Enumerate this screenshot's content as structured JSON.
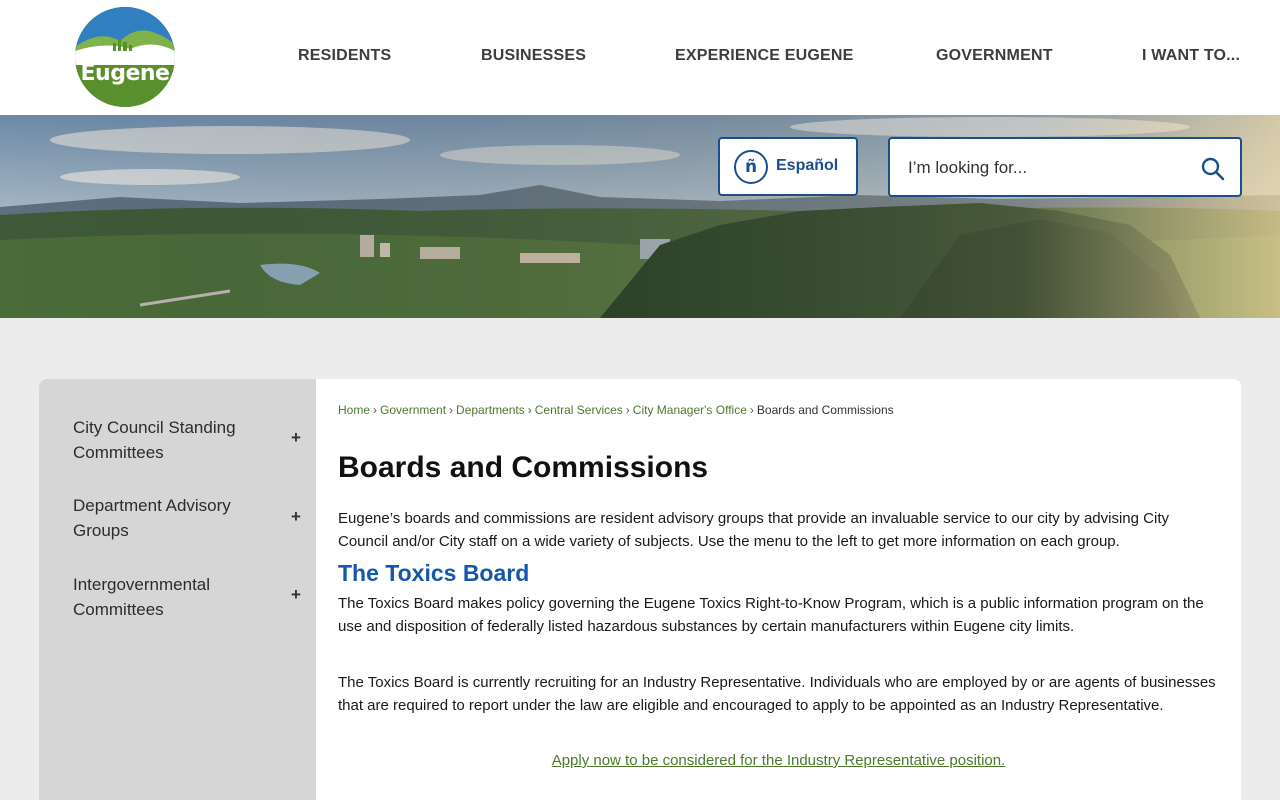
{
  "header": {
    "logo_text": "Eugene",
    "nav": [
      "RESIDENTS",
      "BUSINESSES",
      "EXPERIENCE EUGENE",
      "GOVERNMENT",
      "I WANT TO..."
    ]
  },
  "hero": {
    "language_button": "Español",
    "language_icon": "ñ",
    "search": {
      "placeholder": "I’m looking for..."
    }
  },
  "sidebar": {
    "items": [
      {
        "label": "City Council Standing Committees",
        "expand": "+"
      },
      {
        "label": "Department Advisory Groups",
        "expand": "+"
      },
      {
        "label": "Intergovernmental Committees",
        "expand": "+"
      }
    ]
  },
  "breadcrumb": {
    "links": [
      "Home",
      "Government",
      "Departments",
      "Central Services",
      "City Manager's Office"
    ],
    "separator": "›",
    "current": "Boards and Commissions"
  },
  "main": {
    "title": "Boards and Commissions",
    "intro": "Eugene’s boards and commissions are resident advisory groups that provide an invaluable service to our city by advising City Council and/or City staff on a wide variety of subjects.  Use the menu to the left to get more information on each group.",
    "section_title": "The Toxics Board",
    "section_p1": "The Toxics Board makes policy governing the Eugene Toxics Right-to-Know Program, which is a public information program on the use and disposition of federally listed hazardous substances by certain manufacturers within Eugene city limits.",
    "section_p2": "The Toxics Board is currently recruiting for an Industry Representative.  Individuals who are employed by or are agents of businesses that are required to report under the law are eligible and encouraged to apply to be appointed as an Industry Representative.",
    "apply_link": "Apply now to be considered for the Industry Representative position."
  },
  "colors": {
    "nav_text": "#3d3d3d",
    "brand_blue": "#1b4f8a",
    "link_green": "#4d7a2a",
    "heading_blue": "#1557a8",
    "sidebar_bg": "#d6d6d6"
  }
}
